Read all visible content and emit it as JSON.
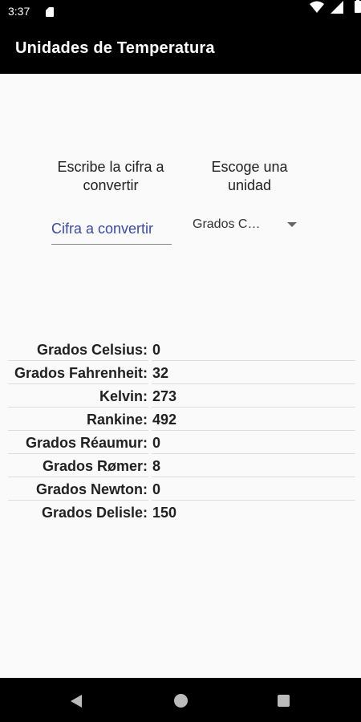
{
  "status_bar": {
    "time": "3:37"
  },
  "app_bar": {
    "title": "Unidades de Temperatura"
  },
  "form": {
    "number_prompt": "Escribe la cifra a convertir",
    "unit_prompt": "Escoge una unidad",
    "number_placeholder": "Cifra a convertir",
    "unit_selected": "Grados C…"
  },
  "results": [
    {
      "label": "Grados Celsius:",
      "value": "0"
    },
    {
      "label": "Grados Fahrenheit:",
      "value": "32"
    },
    {
      "label": "Kelvin:",
      "value": "273"
    },
    {
      "label": "Rankine:",
      "value": "492"
    },
    {
      "label": "Grados Réaumur:",
      "value": "0"
    },
    {
      "label": "Grados Rømer:",
      "value": "8"
    },
    {
      "label": "Grados Newton:",
      "value": "0"
    },
    {
      "label": "Grados Delisle:",
      "value": "150"
    }
  ],
  "icons": {
    "status": [
      "sd-card-icon",
      "wifi-icon",
      "signal-icon",
      "battery-icon"
    ],
    "nav": [
      "back-icon",
      "home-icon",
      "recents-icon"
    ]
  },
  "colors": {
    "accent": "#3949ab",
    "app_bar": "#000000",
    "background": "#fafafa"
  }
}
